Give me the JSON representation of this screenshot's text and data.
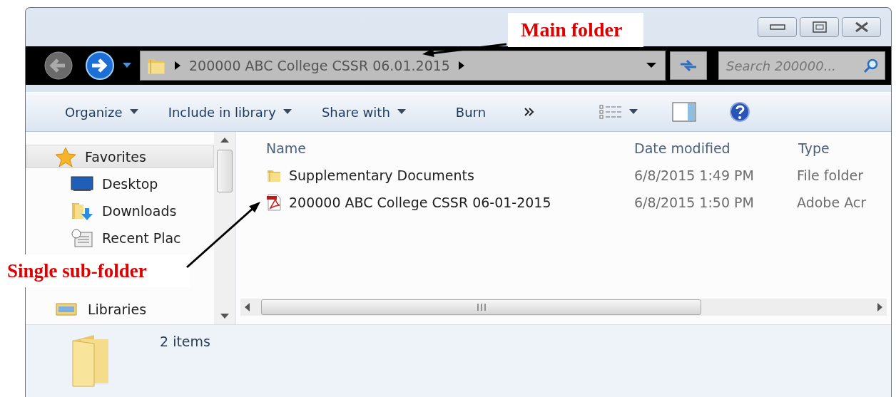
{
  "annotations": [
    {
      "kind": "top",
      "text": "Main folder"
    },
    {
      "kind": "left",
      "text": "Single sub-folder"
    }
  ],
  "address_bar": {
    "path": "200000 ABC College CSSR 06.01.2015"
  },
  "search": {
    "placeholder": "Search 200000..."
  },
  "toolbar": [
    {
      "label": "Organize",
      "dropdown": true
    },
    {
      "label": "Include in library",
      "dropdown": true
    },
    {
      "label": "Share with",
      "dropdown": true
    },
    {
      "label": "Burn",
      "dropdown": false
    }
  ],
  "sidebar": {
    "items": [
      {
        "label": "Favorites",
        "kind": "star",
        "selected": true,
        "children": [
          {
            "label": "Desktop",
            "kind": "desktop",
            "selected": false
          },
          {
            "label": "Downloads",
            "kind": "downloads",
            "selected": false
          },
          {
            "label": "Recent Plac",
            "kind": "recent",
            "selected": false
          }
        ]
      },
      {
        "label": "Libraries",
        "kind": "library",
        "selected": false
      }
    ]
  },
  "table": {
    "columns": [
      "Name",
      "Date modified",
      "Type"
    ],
    "rows": [
      {
        "kind": "folder",
        "name": "Supplementary Documents",
        "date": "6/8/2015 1:49 PM",
        "type": "File folder"
      },
      {
        "kind": "pdf",
        "name": "200000 ABC College CSSR 06-01-2015",
        "date": "6/8/2015 1:50 PM",
        "type": "Adobe Acr"
      }
    ]
  },
  "status_bar": {
    "count": "2 items"
  }
}
